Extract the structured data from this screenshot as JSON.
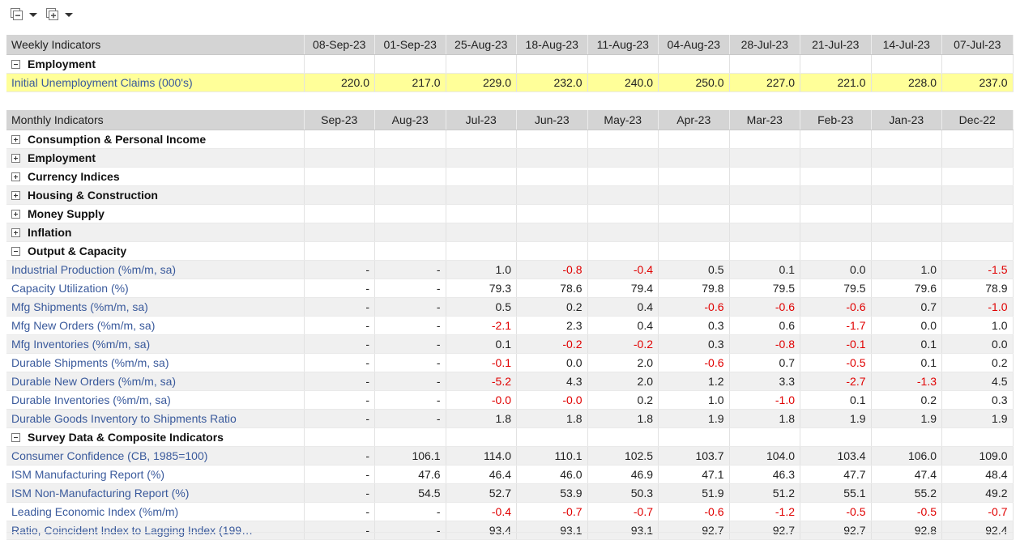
{
  "toolbar": {
    "collapse_icon": "collapse-all-icon",
    "expand_icon": "expand-all-icon"
  },
  "weekly": {
    "header_label": "Weekly Indicators",
    "columns": [
      "08-Sep-23",
      "01-Sep-23",
      "25-Aug-23",
      "18-Aug-23",
      "11-Aug-23",
      "04-Aug-23",
      "28-Jul-23",
      "21-Jul-23",
      "14-Jul-23",
      "07-Jul-23"
    ],
    "category": "Employment",
    "row": {
      "label": "Initial Unemployment Claims (000's)",
      "values": [
        "220.0",
        "217.0",
        "229.0",
        "232.0",
        "240.0",
        "250.0",
        "227.0",
        "221.0",
        "228.0",
        "237.0"
      ]
    }
  },
  "monthly": {
    "header_label": "Monthly Indicators",
    "columns": [
      "Sep-23",
      "Aug-23",
      "Jul-23",
      "Jun-23",
      "May-23",
      "Apr-23",
      "Mar-23",
      "Feb-23",
      "Jan-23",
      "Dec-22"
    ],
    "collapsed": [
      "Consumption & Personal Income",
      "Employment",
      "Currency Indices",
      "Housing & Construction",
      "Money Supply",
      "Inflation"
    ],
    "output": {
      "label": "Output & Capacity",
      "rows": [
        {
          "label": "Industrial Production (%m/m, sa)",
          "values": [
            "-",
            "-",
            "1.0",
            "-0.8",
            "-0.4",
            "0.5",
            "0.1",
            "0.0",
            "1.0",
            "-1.5"
          ]
        },
        {
          "label": "Capacity Utilization (%)",
          "values": [
            "-",
            "-",
            "79.3",
            "78.6",
            "79.4",
            "79.8",
            "79.5",
            "79.5",
            "79.6",
            "78.9"
          ]
        },
        {
          "label": "Mfg Shipments (%m/m, sa)",
          "values": [
            "-",
            "-",
            "0.5",
            "0.2",
            "0.4",
            "-0.6",
            "-0.6",
            "-0.6",
            "0.7",
            "-1.0"
          ]
        },
        {
          "label": "Mfg New Orders (%m/m, sa)",
          "values": [
            "-",
            "-",
            "-2.1",
            "2.3",
            "0.4",
            "0.3",
            "0.6",
            "-1.7",
            "0.0",
            "1.0"
          ]
        },
        {
          "label": "Mfg Inventories (%m/m, sa)",
          "values": [
            "-",
            "-",
            "0.1",
            "-0.2",
            "-0.2",
            "0.3",
            "-0.8",
            "-0.1",
            "0.1",
            "0.0"
          ]
        },
        {
          "label": "Durable Shipments (%m/m, sa)",
          "values": [
            "-",
            "-",
            "-0.1",
            "0.0",
            "2.0",
            "-0.6",
            "0.7",
            "-0.5",
            "0.1",
            "0.2"
          ]
        },
        {
          "label": "Durable New Orders (%m/m, sa)",
          "values": [
            "-",
            "-",
            "-5.2",
            "4.3",
            "2.0",
            "1.2",
            "3.3",
            "-2.7",
            "-1.3",
            "4.5"
          ]
        },
        {
          "label": "Durable Inventories (%m/m, sa)",
          "values": [
            "-",
            "-",
            "-0.0",
            "-0.0",
            "0.2",
            "1.0",
            "-1.0",
            "0.1",
            "0.2",
            "0.3"
          ]
        },
        {
          "label": "Durable Goods Inventory to Shipments Ratio",
          "values": [
            "-",
            "-",
            "1.8",
            "1.8",
            "1.8",
            "1.9",
            "1.8",
            "1.9",
            "1.9",
            "1.9"
          ]
        }
      ]
    },
    "survey": {
      "label": "Survey Data & Composite Indicators",
      "rows": [
        {
          "label": "Consumer Confidence (CB, 1985=100)",
          "values": [
            "-",
            "106.1",
            "114.0",
            "110.1",
            "102.5",
            "103.7",
            "104.0",
            "103.4",
            "106.0",
            "109.0"
          ]
        },
        {
          "label": "ISM Manufacturing Report (%)",
          "values": [
            "-",
            "47.6",
            "46.4",
            "46.0",
            "46.9",
            "47.1",
            "46.3",
            "47.7",
            "47.4",
            "48.4"
          ]
        },
        {
          "label": "ISM Non-Manufacturing Report (%)",
          "values": [
            "-",
            "54.5",
            "52.7",
            "53.9",
            "50.3",
            "51.9",
            "51.2",
            "55.1",
            "55.2",
            "49.2"
          ]
        },
        {
          "label": "Leading Economic Index (%m/m)",
          "values": [
            "-",
            "-",
            "-0.4",
            "-0.7",
            "-0.7",
            "-0.6",
            "-1.2",
            "-0.5",
            "-0.5",
            "-0.7"
          ]
        },
        {
          "label": "Ratio, Coincident Index to Lagging Index (199…",
          "values": [
            "-",
            "-",
            "93.4",
            "93.1",
            "93.1",
            "92.7",
            "92.7",
            "92.7",
            "92.8",
            "92.4"
          ]
        }
      ]
    }
  },
  "colors": {
    "header_bg": "#d4d4d4",
    "highlight_row": "#ffff99",
    "indicator_link": "#3a5a9c",
    "negative": "#e00000",
    "alt_row": "#f0f0f0"
  }
}
